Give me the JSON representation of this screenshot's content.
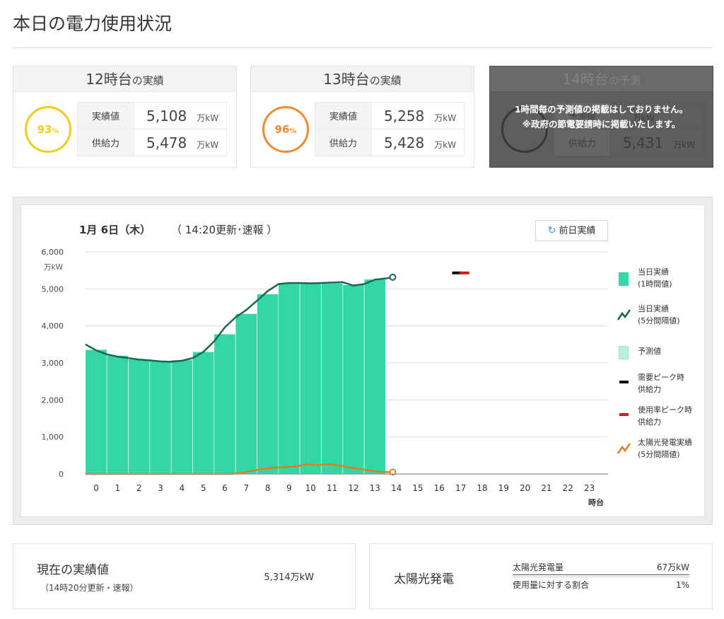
{
  "page_title": "本日の電力使用状況",
  "cards": [
    {
      "hour": "12時台",
      "suffix": "の実績",
      "percent": "93",
      "pct_sign": "%",
      "rows": [
        {
          "label": "実績値",
          "value": "5,108",
          "unit": "万kW"
        },
        {
          "label": "供給力",
          "value": "5,478",
          "unit": "万kW"
        }
      ]
    },
    {
      "hour": "13時台",
      "suffix": "の実績",
      "percent": "96",
      "pct_sign": "%",
      "rows": [
        {
          "label": "実績値",
          "value": "5,258",
          "unit": "万kW"
        },
        {
          "label": "供給力",
          "value": "5,428",
          "unit": "万kW"
        }
      ]
    },
    {
      "hour": "14時台",
      "suffix": "の予測",
      "overlay_line1": "1時間毎の予測値の掲載はしておりません。",
      "overlay_line2": "※政府の節電要請時に掲載いたします。",
      "rows": [
        {
          "label": "予測値",
          "value": "",
          "unit": "万kW"
        },
        {
          "label": "供給力",
          "value": "5,431",
          "unit": "万kW"
        }
      ]
    }
  ],
  "chart_header": {
    "date": "1月 6日（木）",
    "update": "（ 14:20更新･速報 ）",
    "prev_button": "前日実績",
    "prev_icon": "refresh-icon"
  },
  "chart_data": {
    "type": "bar",
    "y_unit": "万kW",
    "x_unit": "時台",
    "ylim": [
      0,
      6000
    ],
    "yticks": [
      "0",
      "1,000",
      "2,000",
      "3,000",
      "4,000",
      "5,000",
      "6,000"
    ],
    "categories": [
      "0",
      "1",
      "2",
      "3",
      "4",
      "5",
      "6",
      "7",
      "8",
      "9",
      "10",
      "11",
      "12",
      "13",
      "14",
      "15",
      "16",
      "17",
      "18",
      "19",
      "20",
      "21",
      "22",
      "23"
    ],
    "grid": true,
    "legend_position": "right",
    "colors": {
      "bar": "#33d6a5",
      "line": "#17684e",
      "solar": "#e27d22",
      "peak_demand": "#111111",
      "peak_usage": "#cc1c1c",
      "forecast": "#b5f0dc"
    },
    "series": [
      {
        "name": "当日実績（1時間値）",
        "kind": "bar",
        "values": [
          3360,
          3200,
          3100,
          3050,
          3080,
          3300,
          3780,
          4330,
          4860,
          5160,
          5170,
          5150,
          5108,
          5258
        ]
      },
      {
        "name": "当日実績（5分間隔値）",
        "kind": "line",
        "x": [
          -0.5,
          0,
          0.5,
          1,
          1.5,
          2,
          2.5,
          3,
          3.5,
          4,
          4.5,
          5,
          5.5,
          6,
          6.5,
          7,
          7.5,
          8,
          8.5,
          9,
          9.5,
          10,
          10.5,
          11,
          11.5,
          12,
          12.5,
          13,
          13.5,
          13.83
        ],
        "values": [
          3500,
          3340,
          3230,
          3170,
          3130,
          3090,
          3070,
          3040,
          3030,
          3060,
          3130,
          3300,
          3580,
          3960,
          4230,
          4430,
          4680,
          4940,
          5130,
          5160,
          5160,
          5150,
          5160,
          5170,
          5180,
          5090,
          5130,
          5250,
          5280,
          5314
        ]
      },
      {
        "name": "予測値",
        "kind": "bar",
        "values": []
      },
      {
        "name": "需要ピーク時供給力",
        "kind": "marker",
        "x": 16.83,
        "value": 5431
      },
      {
        "name": "使用率ピーク時供給力",
        "kind": "marker",
        "x": 17.17,
        "value": 5431
      },
      {
        "name": "太陽光発電実績（5分間隔値）",
        "kind": "line",
        "x": [
          -0.5,
          6.3,
          6.8,
          7.3,
          7.8,
          8.3,
          8.8,
          9.3,
          9.8,
          10.3,
          10.8,
          11.3,
          11.8,
          12.3,
          12.8,
          13.3,
          13.83
        ],
        "values": [
          0,
          0,
          30,
          90,
          140,
          170,
          185,
          205,
          255,
          240,
          265,
          230,
          180,
          130,
          90,
          55,
          50
        ]
      }
    ]
  },
  "legend_labels": {
    "actual_hourly_l1": "当日実績",
    "actual_hourly_l2": "(1時間値)",
    "actual_5min_l1": "当日実績",
    "actual_5min_l2": "(5分間隔値)",
    "forecast": "予測値",
    "peak_demand_l1": "需要ピーク時",
    "peak_demand_l2": "供給力",
    "peak_usage_l1": "使用率ピーク時",
    "peak_usage_l2": "供給力",
    "solar_l1": "太陽光発電実績",
    "solar_l2": "(5分間隔値)"
  },
  "current": {
    "title": "現在の実績値",
    "sub": "（14時20分更新・速報）",
    "value": "5,314万kW"
  },
  "solar": {
    "title": "太陽光発電",
    "rows": [
      {
        "label": "太陽光発電量",
        "value": "67万kW"
      },
      {
        "label": "使用量に対する割合",
        "value": "1%"
      }
    ]
  }
}
